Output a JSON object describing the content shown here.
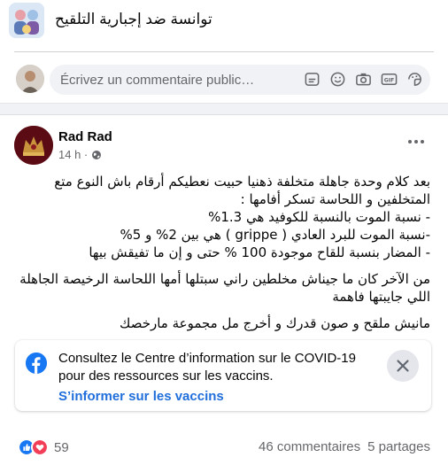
{
  "group": {
    "name": "توانسة ضد إجبارية التلقيح"
  },
  "comment_box": {
    "placeholder": "Écrivez un commentaire public…"
  },
  "comment_icons": [
    "sticker-face-icon",
    "emoji-icon",
    "camera-icon",
    "gif-icon",
    "sticker-icon"
  ],
  "post": {
    "author": "Rad Rad",
    "time": "14 h ·",
    "visibility_icon": "globe-icon",
    "paragraphs": [
      [
        "بعد كلام وحدة جاهلة متخلفة ذهنيا حبيت نعطيكم أرقام باش النوع متع",
        "المتخلفين و اللحاسة تسكر أفامها :",
        "- نسبة الموت بالنسبة للكوفيد هي 1.3%",
        "-نسبة الموت للبرد العادي ( grippe ) هي بين 2% و 5%",
        "- المضار بنسبة للقاح موجودة 100 % حتى و إن ما تفيقش بيها"
      ],
      [
        "من الآخر كان ما جيناش مخلطين  راني سبتلها أمها اللحاسة الرخيصة الجاهلة",
        "اللي جايبتها فاهمة"
      ],
      [
        "مانيش ملقح و صون قدرك و أخرج مل مجموعة مارخصك"
      ]
    ]
  },
  "covid_notice": {
    "text": "Consultez le Centre d’information sur le COVID-19 pour des ressources sur les vaccins.",
    "link": "S’informer sur les vaccins"
  },
  "footer": {
    "reaction_count": "59",
    "comments": "46 commentaires",
    "shares": "5 partages"
  },
  "colors": {
    "accent": "#1877f2",
    "like": "#1877f2",
    "love": "#f33e58",
    "text_secondary": "#65676b"
  }
}
